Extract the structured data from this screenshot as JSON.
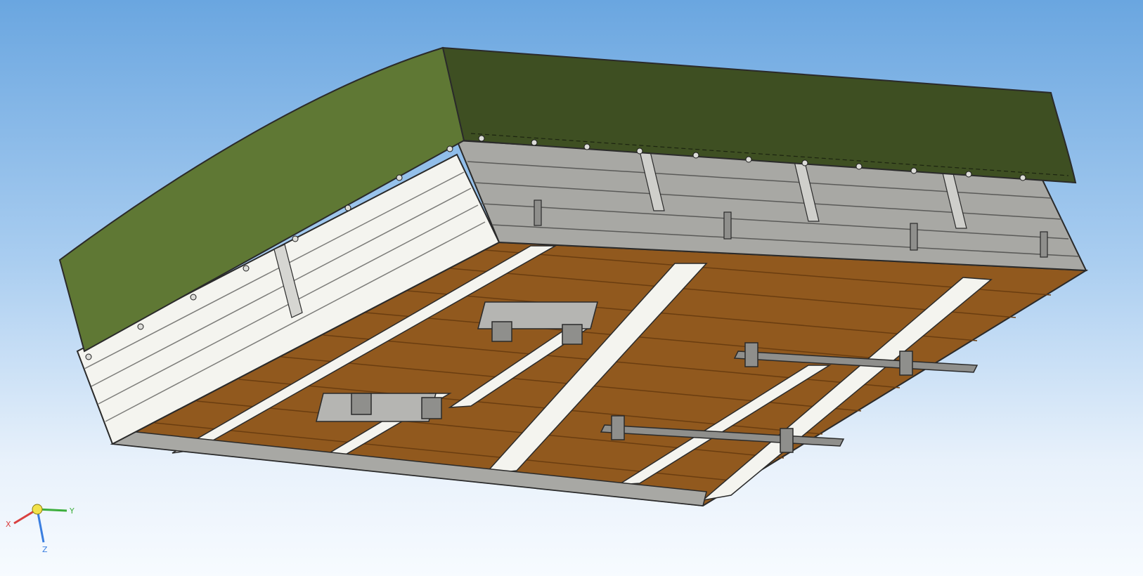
{
  "viewport": {
    "colors": {
      "tarp_side": "#5f7834",
      "tarp_top": "#3e4f22",
      "board_light": "#f4f4ef",
      "board_mid": "#a8a8a4",
      "board_dark": "#7d7d7a",
      "floor_wood": "#91591e",
      "floor_plank_line": "#6a3d10",
      "edge": "#2a2a2a"
    }
  },
  "triad": {
    "x_label": "X",
    "y_label": "Y",
    "z_label": "Z",
    "colors": {
      "x": "#d94040",
      "y": "#3cae3c",
      "z": "#3a7ee0",
      "origin": "#f2e24a"
    }
  }
}
